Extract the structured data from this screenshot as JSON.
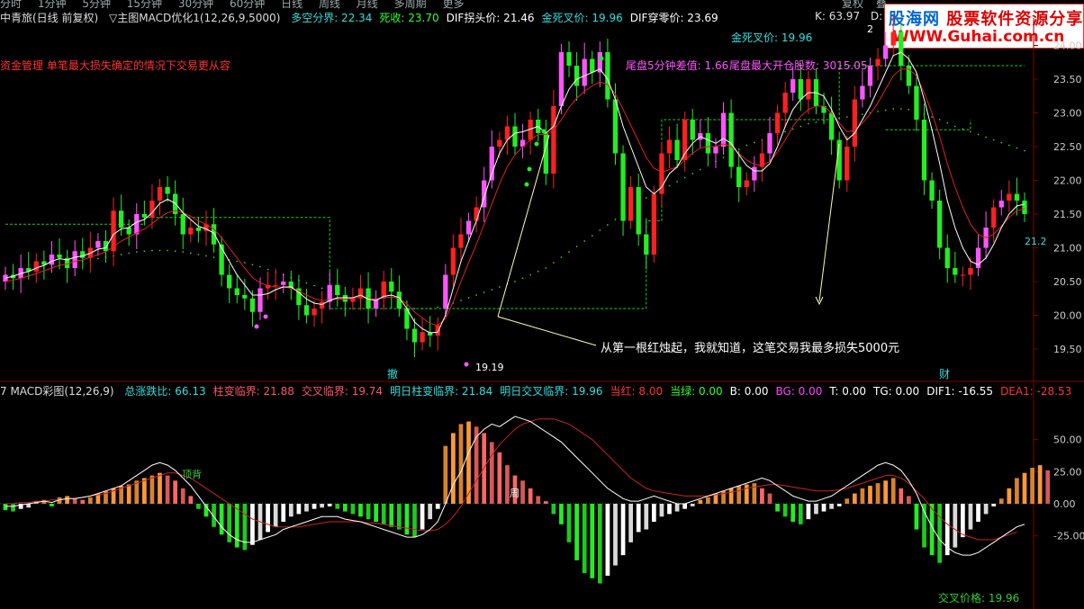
{
  "topbar": {
    "items": [
      "分时",
      "1分钟",
      "5分钟",
      "15分钟",
      "30分钟",
      "60分钟",
      "日线",
      "周线",
      "月线",
      "多周期",
      "更多"
    ],
    "right_items": [
      "复权",
      "叠"
    ]
  },
  "main_info": {
    "title": "中青旅(日线 前复权)",
    "indicator": "▽主图MACD优化1(12,26,9,5000)",
    "fields": [
      {
        "label": "多空分界:",
        "value": "22.34",
        "color": "#33dddd"
      },
      {
        "label": "死收:",
        "value": "23.70",
        "color": "#33ff33"
      },
      {
        "label": "DIF拐头价:",
        "value": "21.46",
        "color": "#ffffff"
      },
      {
        "label": "金死叉价:",
        "value": "19.96",
        "color": "#33dddd"
      },
      {
        "label": "DIF穿零价:",
        "value": "23.69",
        "color": "#ffffff"
      }
    ],
    "k_label": "K: 63.97",
    "d_label": "D: 7"
  },
  "logo": {
    "line1_a": "股海网",
    "line1_b": "股票软件资源分享",
    "line2": "WWW.Guhai.com.cn"
  },
  "annotations": {
    "risk_note": "资金管理 单笔最大损失确定的情况下交易更从容",
    "tail_diff": "尾盘5分钟差值: 1.66",
    "tail_lots": "尾盘最大开仓股数: 3015.05",
    "golden_cross": "金死叉价: 19.96",
    "first_red": "从第一根红烛起，我就知道，这笔交易我最多损失5000元",
    "low_label": "19.19",
    "marker_left": "撤",
    "marker_right": "财",
    "top_label": "2",
    "last_price": "21.2",
    "top_back": "顶背",
    "week_mark": "周",
    "cross_price": "交叉价格: 19.96"
  },
  "right_axis": {
    "main": [
      "24.00",
      "23.50",
      "23.00",
      "22.50",
      "22.00",
      "21.50",
      "21.00",
      "20.50",
      "20.00",
      "19.50"
    ],
    "sub": [
      "50.00",
      "25.00",
      "0.00",
      "-25.00"
    ]
  },
  "sub_info": {
    "title": "7 MACD彩图(12,26,9)",
    "fields": [
      {
        "label": "总涨跌比:",
        "value": "66.13",
        "color": "#33dddd"
      },
      {
        "label": "柱变临界:",
        "value": "21.88",
        "color": "#ff5566"
      },
      {
        "label": "交叉临界:",
        "value": "19.74",
        "color": "#ff5566"
      },
      {
        "label": "明日柱变临界:",
        "value": "21.84",
        "color": "#33dddd"
      },
      {
        "label": "明日交叉临界:",
        "value": "19.96",
        "color": "#33dddd"
      },
      {
        "label": "当红:",
        "value": "8.00",
        "color": "#ff3333"
      },
      {
        "label": "当绿:",
        "value": "0.00",
        "color": "#33ff33"
      },
      {
        "label": "B:",
        "value": "0.00",
        "color": "#ffffff"
      },
      {
        "label": "BG:",
        "value": "0.00",
        "color": "#ff44ff"
      },
      {
        "label": "T:",
        "value": "0.00",
        "color": "#ffffff"
      },
      {
        "label": "TG:",
        "value": "0.00",
        "color": "#ffffff"
      },
      {
        "label": "DIF1:",
        "value": "-16.55",
        "color": "#ffffff"
      },
      {
        "label": "DEA1:",
        "value": "-28.53",
        "color": "#ff3333"
      }
    ]
  },
  "colors": {
    "up": "#ff2020",
    "down": "#22ee22",
    "strong_up": "#ff55ff",
    "axis": "#800000",
    "orange": "#ff9933"
  },
  "chart_data": {
    "type": "candlestick",
    "ylim": [
      19.1,
      24.3
    ],
    "closes": [
      20.6,
      20.55,
      20.7,
      20.65,
      20.8,
      20.75,
      20.9,
      20.85,
      20.7,
      20.95,
      20.85,
      21.0,
      21.1,
      20.95,
      21.55,
      21.3,
      21.2,
      21.5,
      21.45,
      21.7,
      21.9,
      21.8,
      21.5,
      21.2,
      21.3,
      21.25,
      21.35,
      21.05,
      20.6,
      20.4,
      20.3,
      20.25,
      20.05,
      20.4,
      20.45,
      20.45,
      20.5,
      20.4,
      20.15,
      20.0,
      20.1,
      20.2,
      20.45,
      20.3,
      20.2,
      20.25,
      20.4,
      20.1,
      20.25,
      20.5,
      20.35,
      20.1,
      19.8,
      19.6,
      19.75,
      19.7,
      19.85,
      20.6,
      21.0,
      21.2,
      21.4,
      21.6,
      22.0,
      22.5,
      22.6,
      22.8,
      22.5,
      22.6,
      22.9,
      22.7,
      22.1,
      23.1,
      23.9,
      23.7,
      23.4,
      23.8,
      23.6,
      23.9,
      23.2,
      22.4,
      21.4,
      21.9,
      21.2,
      20.9,
      21.8,
      22.4,
      22.6,
      22.3,
      22.9,
      22.6,
      22.7,
      22.4,
      22.5,
      23.0,
      22.2,
      21.9,
      22.0,
      22.2,
      22.4,
      22.7,
      23.0,
      23.3,
      23.5,
      23.2,
      23.5,
      23.1,
      23.0,
      22.6,
      22.0,
      22.5,
      23.2,
      23.4,
      23.7,
      23.8,
      24.0,
      24.2,
      23.7,
      23.4,
      22.9,
      22.0,
      21.7,
      21.0,
      20.7,
      20.6,
      20.6,
      20.7,
      21.0,
      21.3,
      21.6,
      21.7,
      21.8,
      21.7,
      21.5
    ],
    "opens": [
      20.5,
      20.6,
      20.55,
      20.7,
      20.65,
      20.8,
      20.75,
      20.9,
      20.85,
      20.7,
      20.95,
      20.85,
      21.0,
      21.1,
      20.95,
      21.55,
      21.3,
      21.2,
      21.5,
      21.45,
      21.7,
      21.9,
      21.8,
      21.5,
      21.2,
      21.3,
      21.25,
      21.35,
      21.05,
      20.6,
      20.4,
      20.3,
      20.25,
      20.05,
      20.4,
      20.45,
      20.45,
      20.5,
      20.4,
      20.15,
      20.0,
      20.1,
      20.2,
      20.45,
      20.3,
      20.2,
      20.25,
      20.4,
      20.1,
      20.25,
      20.5,
      20.35,
      20.1,
      19.8,
      19.6,
      19.75,
      19.7,
      20.1,
      20.6,
      21.0,
      21.2,
      21.4,
      21.6,
      22.0,
      22.5,
      22.6,
      22.8,
      22.5,
      22.6,
      22.9,
      22.7,
      22.1,
      23.1,
      23.9,
      23.7,
      23.4,
      23.8,
      23.6,
      23.9,
      23.2,
      22.4,
      21.4,
      21.9,
      21.2,
      20.9,
      21.8,
      22.4,
      22.6,
      22.3,
      22.9,
      22.6,
      22.7,
      22.4,
      22.5,
      23.0,
      22.2,
      21.9,
      22.0,
      22.2,
      22.4,
      22.7,
      23.0,
      23.3,
      23.5,
      23.2,
      23.5,
      23.1,
      23.0,
      22.6,
      22.0,
      22.5,
      23.2,
      23.4,
      23.7,
      23.8,
      24.0,
      24.2,
      23.7,
      23.4,
      22.9,
      22.0,
      21.7,
      21.0,
      20.7,
      20.6,
      20.6,
      20.7,
      21.0,
      21.3,
      21.6,
      21.7,
      21.8,
      21.7
    ],
    "ma_white": [
      20.55,
      20.58,
      20.62,
      20.65,
      20.7,
      20.74,
      20.8,
      20.84,
      20.82,
      20.86,
      20.88,
      20.92,
      20.98,
      21.0,
      21.2,
      21.28,
      21.3,
      21.38,
      21.42,
      21.52,
      21.66,
      21.72,
      21.66,
      21.52,
      21.42,
      21.32,
      21.28,
      21.22,
      21.0,
      20.8,
      20.6,
      20.45,
      20.3,
      20.3,
      20.32,
      20.38,
      20.42,
      20.42,
      20.34,
      20.24,
      20.18,
      20.16,
      20.22,
      20.26,
      20.26,
      20.26,
      20.3,
      20.24,
      20.22,
      20.28,
      20.3,
      20.26,
      20.1,
      19.9,
      19.8,
      19.74,
      19.75,
      20.0,
      20.4,
      20.8,
      21.1,
      21.4,
      21.75,
      22.1,
      22.4,
      22.6,
      22.7,
      22.72,
      22.76,
      22.8,
      22.7,
      22.8,
      23.1,
      23.35,
      23.5,
      23.55,
      23.6,
      23.65,
      23.5,
      23.2,
      22.8,
      22.5,
      22.2,
      21.9,
      21.8,
      21.9,
      22.1,
      22.2,
      22.4,
      22.55,
      22.65,
      22.6,
      22.55,
      22.62,
      22.55,
      22.38,
      22.22,
      22.14,
      22.14,
      22.25,
      22.5,
      22.8,
      23.05,
      23.2,
      23.3,
      23.3,
      23.25,
      23.05,
      22.8,
      22.6,
      22.7,
      22.9,
      23.1,
      23.35,
      23.6,
      23.85,
      23.9,
      23.8,
      23.6,
      23.2,
      22.75,
      22.25,
      21.7,
      21.3,
      21.0,
      20.8,
      20.75,
      20.85,
      21.05,
      21.3,
      21.5,
      21.62,
      21.65
    ],
    "ma_red": [
      20.5,
      20.52,
      20.55,
      20.58,
      20.62,
      20.66,
      20.7,
      20.74,
      20.76,
      20.8,
      20.82,
      20.86,
      20.9,
      20.94,
      21.02,
      21.1,
      21.16,
      21.22,
      21.28,
      21.36,
      21.45,
      21.52,
      21.55,
      21.52,
      21.47,
      21.4,
      21.35,
      21.28,
      21.15,
      21.0,
      20.85,
      20.7,
      20.56,
      20.48,
      20.44,
      20.42,
      20.42,
      20.4,
      20.36,
      20.3,
      20.25,
      20.22,
      20.23,
      20.24,
      20.24,
      20.25,
      20.27,
      20.25,
      20.24,
      20.26,
      20.27,
      20.25,
      20.17,
      20.05,
      19.96,
      19.88,
      19.85,
      19.95,
      20.2,
      20.5,
      20.78,
      21.05,
      21.35,
      21.65,
      21.95,
      22.2,
      22.38,
      22.5,
      22.6,
      22.68,
      22.68,
      22.74,
      22.9,
      23.08,
      23.22,
      23.32,
      23.4,
      23.46,
      23.42,
      23.28,
      23.05,
      22.82,
      22.58,
      22.34,
      22.18,
      22.12,
      22.16,
      22.2,
      22.3,
      22.4,
      22.48,
      22.5,
      22.5,
      22.54,
      22.5,
      22.4,
      22.3,
      22.24,
      22.22,
      22.28,
      22.42,
      22.6,
      22.8,
      22.95,
      23.05,
      23.1,
      23.1,
      23.0,
      22.85,
      22.72,
      22.74,
      22.85,
      22.98,
      23.15,
      23.35,
      23.55,
      23.65,
      23.65,
      23.55,
      23.3,
      23.0,
      22.65,
      22.25,
      21.9,
      21.6,
      21.35,
      21.2,
      21.15,
      21.2,
      21.32,
      21.45,
      21.55,
      21.58
    ],
    "ma_dots": [
      20.6,
      20.62,
      20.64,
      20.66,
      20.68,
      20.7,
      20.72,
      20.74,
      20.76,
      20.78,
      20.8,
      20.82,
      20.84,
      20.86,
      20.88,
      20.9,
      20.92,
      20.94,
      20.95,
      20.96,
      20.96,
      20.96,
      20.95,
      20.94,
      20.92,
      20.9,
      20.88,
      20.86,
      20.84,
      20.82,
      20.8,
      20.78,
      20.75,
      20.72,
      20.68,
      20.64,
      20.6,
      20.56,
      20.52,
      20.48,
      20.44,
      20.4,
      20.36,
      20.32,
      20.28,
      20.24,
      20.2,
      20.18,
      20.16,
      20.14,
      20.12,
      20.1,
      20.1,
      20.1,
      20.1,
      20.1,
      20.12,
      20.14,
      20.18,
      20.22,
      20.26,
      20.3,
      20.34,
      20.38,
      20.42,
      20.46,
      20.5,
      20.55,
      20.6,
      20.65,
      20.7,
      20.78,
      20.86,
      20.94,
      21.02,
      21.1,
      21.18,
      21.26,
      21.34,
      21.42,
      21.5,
      21.58,
      21.66,
      21.74,
      21.8,
      21.86,
      21.92,
      21.98,
      22.04,
      22.1,
      22.16,
      22.22,
      22.28,
      22.34,
      22.4,
      22.46,
      22.52,
      22.56,
      22.6,
      22.64,
      22.68,
      22.72,
      22.76,
      22.8,
      22.84,
      22.86,
      22.88,
      22.9,
      22.92,
      22.94,
      22.96,
      22.98,
      23.0,
      23.02,
      23.04,
      23.06,
      23.06,
      23.05,
      23.02,
      22.98,
      22.94,
      22.9,
      22.85,
      22.8,
      22.76,
      22.72,
      22.68,
      22.64,
      22.6,
      22.56,
      22.52,
      22.48,
      22.44
    ],
    "macd": {
      "ylim": [
        -50,
        70
      ],
      "hist": [
        -5,
        -6,
        -4,
        -3,
        2,
        3,
        -2,
        5,
        6,
        4,
        3,
        5,
        8,
        10,
        12,
        14,
        15,
        18,
        20,
        22,
        24,
        22,
        18,
        12,
        6,
        -4,
        -10,
        -18,
        -24,
        -30,
        -34,
        -36,
        -32,
        -28,
        -22,
        -18,
        -14,
        -10,
        -8,
        -6,
        -4,
        -3,
        -2,
        -4,
        -6,
        -8,
        -10,
        -12,
        -14,
        -16,
        -18,
        -20,
        -24,
        -26,
        -20,
        -12,
        -4,
        45,
        55,
        62,
        64,
        60,
        55,
        48,
        40,
        30,
        22,
        18,
        12,
        6,
        2,
        -8,
        -16,
        -30,
        -44,
        -54,
        -58,
        -62,
        -56,
        -48,
        -40,
        -30,
        -22,
        -20,
        -14,
        -10,
        -8,
        -6,
        -4,
        -2,
        3,
        5,
        8,
        10,
        12,
        14,
        15,
        16,
        12,
        8,
        -6,
        -10,
        -14,
        -16,
        -12,
        -8,
        -6,
        -4,
        -2,
        4,
        8,
        12,
        14,
        16,
        18,
        20,
        12,
        6,
        -20,
        -34,
        -40,
        -46,
        -40,
        -34,
        -26,
        -20,
        -14,
        -8,
        -2,
        4,
        12,
        20,
        24,
        28,
        30,
        26
      ],
      "dif": [
        -2,
        -2,
        -1,
        0,
        1,
        2,
        1,
        3,
        4,
        4,
        5,
        6,
        8,
        10,
        12,
        14,
        18,
        22,
        26,
        30,
        32,
        30,
        26,
        20,
        14,
        6,
        -2,
        -10,
        -18,
        -24,
        -28,
        -30,
        -30,
        -28,
        -26,
        -24,
        -20,
        -18,
        -16,
        -14,
        -12,
        -10,
        -10,
        -10,
        -12,
        -13,
        -14,
        -16,
        -18,
        -20,
        -22,
        -24,
        -26,
        -26,
        -24,
        -20,
        -14,
        0,
        15,
        25,
        40,
        52,
        58,
        62,
        60,
        64,
        68,
        66,
        64,
        60,
        56,
        52,
        48,
        42,
        36,
        30,
        24,
        18,
        12,
        8,
        4,
        2,
        2,
        4,
        6,
        4,
        2,
        0,
        0,
        2,
        4,
        6,
        8,
        10,
        12,
        14,
        16,
        18,
        20,
        18,
        14,
        10,
        6,
        4,
        2,
        2,
        4,
        6,
        10,
        14,
        18,
        22,
        26,
        30,
        32,
        30,
        26,
        18,
        8,
        -6,
        -18,
        -28,
        -34,
        -38,
        -40,
        -40,
        -38,
        -34,
        -30,
        -26,
        -22,
        -18,
        -16
      ],
      "dea": [
        0,
        0,
        1,
        1,
        2,
        2,
        3,
        3,
        4,
        4,
        5,
        6,
        7,
        8,
        10,
        12,
        14,
        16,
        18,
        20,
        22,
        24,
        24,
        22,
        20,
        16,
        12,
        8,
        4,
        0,
        -4,
        -8,
        -12,
        -14,
        -16,
        -18,
        -18,
        -18,
        -18,
        -17,
        -16,
        -15,
        -14,
        -14,
        -14,
        -14,
        -14,
        -15,
        -15,
        -16,
        -17,
        -18,
        -19,
        -20,
        -21,
        -21,
        -20,
        -16,
        -10,
        -2,
        8,
        18,
        28,
        38,
        46,
        52,
        58,
        62,
        64,
        66,
        66,
        66,
        64,
        62,
        58,
        54,
        50,
        44,
        38,
        32,
        26,
        20,
        16,
        12,
        10,
        9,
        8,
        7,
        6,
        6,
        6,
        6,
        7,
        8,
        9,
        10,
        12,
        13,
        14,
        15,
        15,
        14,
        13,
        12,
        11,
        10,
        10,
        10,
        11,
        12,
        14,
        16,
        18,
        20,
        22,
        22,
        20,
        16,
        10,
        4,
        -4,
        -10,
        -16,
        -20,
        -24,
        -26,
        -28,
        -28,
        -28,
        -26,
        -24,
        -22
      ]
    }
  }
}
